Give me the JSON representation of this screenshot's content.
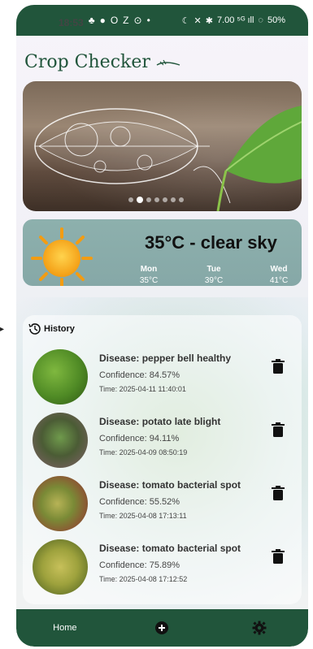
{
  "status": {
    "time": "18:53",
    "left_icons": [
      "♣",
      "●",
      "O",
      "Z",
      "⊙",
      "•"
    ],
    "right_text": "7.00 ⁵ᴳ ıll",
    "battery": "50%"
  },
  "app": {
    "title": "Crop Checker"
  },
  "carousel": {
    "dots": 7,
    "active_index": 1
  },
  "weather": {
    "headline": "35°C - clear sky",
    "days": [
      {
        "name": "Mon",
        "temp": "35°C",
        "icon": "sun"
      },
      {
        "name": "Tue",
        "temp": "39°C",
        "icon": "sun"
      },
      {
        "name": "Wed",
        "temp": "41°C",
        "icon": "cloud"
      }
    ]
  },
  "history": {
    "title": "History",
    "items": [
      {
        "disease": "Disease: pepper bell healthy",
        "confidence": "Confidence: 84.57%",
        "time": "Time: 2025-04-11 11:40:01"
      },
      {
        "disease": "Disease: potato late blight",
        "confidence": "Confidence: 94.11%",
        "time": "Time: 2025-04-09 08:50:19"
      },
      {
        "disease": "Disease: tomato bacterial spot",
        "confidence": "Confidence: 55.52%",
        "time": "Time: 2025-04-08 17:13:11"
      },
      {
        "disease": "Disease: tomato bacterial spot",
        "confidence": "Confidence: 75.89%",
        "time": "Time: 2025-04-08 17:12:52"
      }
    ]
  },
  "nav": {
    "home_label": "Home",
    "add_icon": "plus-circle-icon",
    "settings_icon": "gear-icon"
  },
  "colors": {
    "primary": "#21553b",
    "weather_bg": "#8db0ad"
  }
}
